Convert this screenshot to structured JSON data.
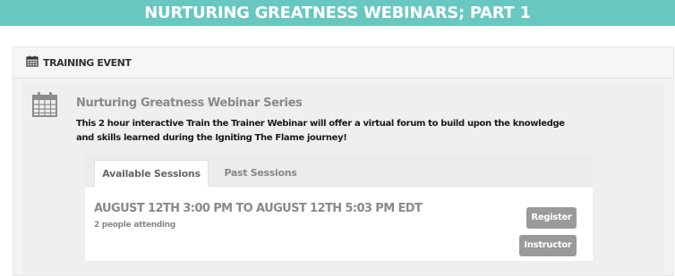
{
  "banner": {
    "title": "NURTURING GREATNESS WEBINARS; PART 1"
  },
  "section": {
    "icon": "calendar-icon",
    "label": "TRAINING EVENT"
  },
  "event": {
    "icon": "calendar-icon",
    "title": "Nurturing Greatness Webinar Series",
    "description": "This 2 hour interactive Train the Trainer Webinar will offer a virtual forum to build upon the knowledge and skills learned during the Igniting The Flame journey!"
  },
  "tabs": [
    {
      "label": "Available Sessions",
      "active": true
    },
    {
      "label": "Past Sessions",
      "active": false
    }
  ],
  "session": {
    "time": "AUGUST 12TH 3:00 PM TO AUGUST 12TH 5:03 PM EDT",
    "attending": "2 people attending",
    "register_label": "Register",
    "instructor_label": "Instructor"
  },
  "colors": {
    "banner": "#68c7c1",
    "button": "#9a9a9a"
  }
}
